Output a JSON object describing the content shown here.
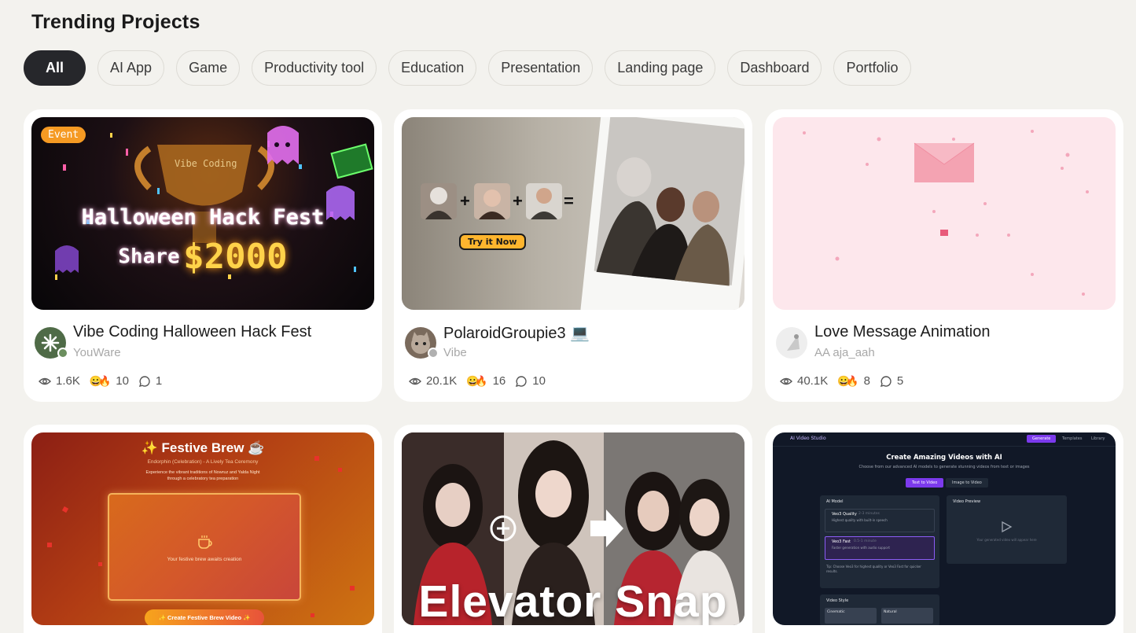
{
  "page": {
    "title": "Trending Projects"
  },
  "filters": [
    {
      "label": "All",
      "active": true
    },
    {
      "label": "AI App",
      "active": false
    },
    {
      "label": "Game",
      "active": false
    },
    {
      "label": "Productivity tool",
      "active": false
    },
    {
      "label": "Education",
      "active": false
    },
    {
      "label": "Presentation",
      "active": false
    },
    {
      "label": "Landing page",
      "active": false
    },
    {
      "label": "Dashboard",
      "active": false
    },
    {
      "label": "Portfolio",
      "active": false
    }
  ],
  "cards": [
    {
      "title": "Vibe Coding Halloween Hack Fest",
      "author": "YouWare",
      "views": "1.6K",
      "reactions": "10",
      "comments": "1",
      "thumb": {
        "badge": "Event",
        "line1": "Halloween Hack Fest",
        "share": "Share",
        "amount": "$2000",
        "trophy": "Vibe Coding"
      }
    },
    {
      "title": "PolaroidGroupie3 💻",
      "author": "Vibe",
      "views": "20.1K",
      "reactions": "16",
      "comments": "10",
      "thumb": {
        "cta": "Try it Now",
        "plus": "+",
        "equals": "="
      }
    },
    {
      "title": "Love Message Animation",
      "author": "AA aja_aah",
      "views": "40.1K",
      "reactions": "8",
      "comments": "5",
      "thumb": {}
    },
    {
      "title": "",
      "author": "",
      "views": "",
      "reactions": "",
      "comments": "",
      "thumb": {
        "heading": "✨ Festive Brew ☕",
        "sub1": "Endorphin (Celebration) - A Lively Tea Ceremony",
        "sub2": "Experience the vibrant traditions of Nowruz and Yalda Night through a celebratory tea preparation",
        "empty": "Your festive brew awaits creation",
        "button": "✨ Create Festive Brew Video ✨"
      }
    },
    {
      "title": "",
      "author": "",
      "views": "",
      "reactions": "",
      "comments": "",
      "thumb": {
        "caption": "Elevator Snap",
        "plus": "+"
      }
    },
    {
      "title": "",
      "author": "",
      "views": "",
      "reactions": "",
      "comments": "",
      "thumb": {
        "app": "AI Video Studio",
        "nav": [
          "Generate",
          "Templates",
          "Library"
        ],
        "heading": "Create Amazing Videos with AI",
        "sub": "Choose from our advanced AI models to generate stunning videos from text or images",
        "tabs": [
          "Text to Video",
          "Image to Video"
        ],
        "model_title": "AI Model",
        "model1": "Veo3 Quality",
        "model1_time": "2-3 minutes",
        "model1_desc": "Highest quality with built-in speech",
        "model2": "Veo3 Fast",
        "model2_time": "0.5-1 minute",
        "model2_desc": "Faster generation with audio support",
        "tip": "Tip: Choose Veo3 for highest quality or Veo3 Fast for quicker results.",
        "preview_title": "Video Preview",
        "preview_text": "Your generated video will appear here",
        "style_title": "Video Style",
        "style1": "Cinematic",
        "style2": "Natural"
      }
    }
  ],
  "colors": {
    "background": "#f3f2ee",
    "chip_active": "#26272b",
    "event_badge": "#f59a23",
    "gold": "#ffd34a"
  }
}
